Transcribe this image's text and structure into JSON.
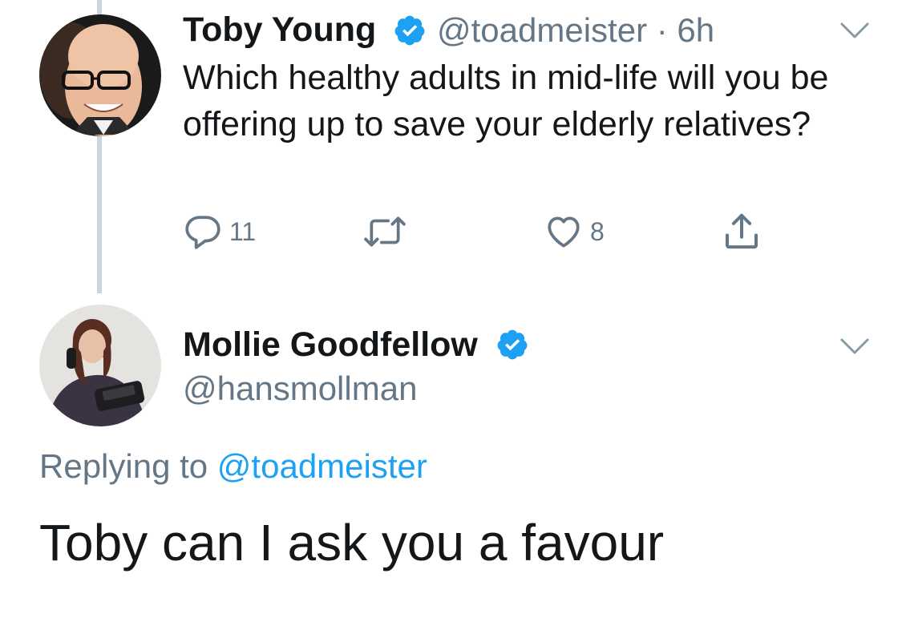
{
  "original_tweet": {
    "author_name": "Toby Young",
    "author_handle": "@toadmeister",
    "separator": "·",
    "timestamp": "6h",
    "text": "Which healthy adults in mid-life will you be offering up to save your elderly relatives?",
    "actions": {
      "reply_icon": "reply-icon",
      "reply_count": "11",
      "retweet_icon": "retweet-icon",
      "like_icon": "heart-icon",
      "like_count": "8",
      "share_icon": "share-icon"
    },
    "verified_icon": "verified-badge-icon",
    "menu_icon": "chevron-down-icon"
  },
  "reply_tweet": {
    "author_name": "Mollie Goodfellow",
    "author_handle": "@hansmollman",
    "replying_prefix": "Replying to",
    "replying_to": "@toadmeister",
    "text": "Toby can I ask you a favour",
    "verified_icon": "verified-badge-icon",
    "menu_icon": "chevron-down-icon"
  },
  "colors": {
    "text_primary": "#14171a",
    "text_secondary": "#657786",
    "link": "#1da1f2",
    "verified": "#1da1f2",
    "thread_line": "#cbd6df"
  }
}
